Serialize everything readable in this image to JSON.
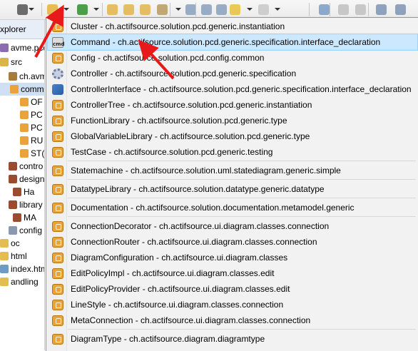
{
  "explorer": {
    "tab_label": "xplorer",
    "tree": [
      {
        "label": "avme.pcd.se",
        "icon": "project-icon"
      },
      {
        "label": "src",
        "icon": "source-folder-icon"
      },
      {
        "label": "ch.avme.p",
        "icon": "package-icon"
      },
      {
        "label": "comm",
        "icon": "class-icon",
        "selected": true
      },
      {
        "label": "OF",
        "icon": "class-icon"
      },
      {
        "label": "PC",
        "icon": "class-icon"
      },
      {
        "label": "PC",
        "icon": "class-icon"
      },
      {
        "label": "RU",
        "icon": "class-icon"
      },
      {
        "label": "ST(",
        "icon": "class-icon"
      },
      {
        "label": "contro",
        "icon": "component-icon"
      },
      {
        "label": "design",
        "icon": "component-icon"
      },
      {
        "label": "Ha",
        "icon": "component-icon"
      },
      {
        "label": "library",
        "icon": "component-icon"
      },
      {
        "label": "MA",
        "icon": "component-icon"
      },
      {
        "label": "config",
        "icon": "gear-icon"
      },
      {
        "label": "oc",
        "icon": "folder-icon"
      },
      {
        "label": "html",
        "icon": "folder-icon"
      },
      {
        "label": "index.htm",
        "icon": "file-icon"
      },
      {
        "label": "andling",
        "icon": "folder-icon"
      }
    ]
  },
  "menu": {
    "items": [
      {
        "label": "Cluster - ch.actifsource.solution.pcd.generic.instantiation",
        "icon": "cluster-icon"
      },
      {
        "label": "Command - ch.actifsource.solution.pcd.generic.specification.interface_declaration",
        "icon": "command-icon",
        "highlighted": true
      },
      {
        "label": "Config - ch.actifsource.solution.pcd.config.common",
        "icon": "config-icon"
      },
      {
        "label": "Controller - ch.actifsource.solution.pcd.generic.specification",
        "icon": "controller-icon"
      },
      {
        "label": "ControllerInterface - ch.actifsource.solution.pcd.generic.specification.interface_declaration",
        "icon": "controller-interface-icon"
      },
      {
        "label": "ControllerTree - ch.actifsource.solution.pcd.generic.instantiation",
        "icon": "controller-tree-icon"
      },
      {
        "label": "FunctionLibrary - ch.actifsource.solution.pcd.generic.type",
        "icon": "function-library-icon"
      },
      {
        "label": "GlobalVariableLibrary - ch.actifsource.solution.pcd.generic.type",
        "icon": "global-variable-library-icon"
      },
      {
        "label": "TestCase - ch.actifsource.solution.pcd.generic.testing",
        "icon": "testcase-icon"
      },
      {
        "label": "Statemachine - ch.actifsource.solution.uml.statediagram.generic.simple",
        "icon": "statemachine-icon"
      },
      {
        "label": "DatatypeLibrary - ch.actifsource.solution.datatype.generic.datatype",
        "icon": "datatype-library-icon"
      },
      {
        "label": "Documentation - ch.actifsource.solution.documentation.metamodel.generic",
        "icon": "documentation-icon"
      },
      {
        "label": "ConnectionDecorator - ch.actifsource.ui.diagram.classes.connection",
        "icon": "connection-decorator-icon"
      },
      {
        "label": "ConnectionRouter - ch.actifsource.ui.diagram.classes.connection",
        "icon": "connection-router-icon"
      },
      {
        "label": "DiagramConfiguration - ch.actifsource.ui.diagram.classes",
        "icon": "diagram-configuration-icon"
      },
      {
        "label": "EditPolicyImpl - ch.actifsource.ui.diagram.classes.edit",
        "icon": "edit-policy-impl-icon"
      },
      {
        "label": "EditPolicyProvider - ch.actifsource.ui.diagram.classes.edit",
        "icon": "edit-policy-provider-icon"
      },
      {
        "label": "LineStyle - ch.actifsource.ui.diagram.classes.connection",
        "icon": "line-style-icon"
      },
      {
        "label": "MetaConnection - ch.actifsource.ui.diagram.classes.connection",
        "icon": "meta-connection-icon"
      },
      {
        "label": "DiagramType - ch.actifsource.diagram.diagramtype",
        "icon": "diagram-type-icon"
      }
    ]
  },
  "toolbar": {
    "icons": [
      "debug-profile-icon",
      "dropdown-icon",
      "new-resource-icon",
      "dropdown-icon",
      "run-icon",
      "dropdown-icon",
      "open-folder-icon",
      "open-folder-icon",
      "open-folder-icon",
      "wand-icon",
      "dropdown-icon",
      "next-annotation-icon",
      "previous-annotation-icon",
      "last-edit-icon",
      "back-icon",
      "dropdown-icon",
      "forward-icon",
      "dropdown-icon",
      "maximize-icon",
      "undo-icon",
      "redo-icon",
      "layout-icon",
      "layout-icon"
    ]
  },
  "colors": {
    "highlight": "#cce8ff",
    "arrow": "#e8191b"
  }
}
